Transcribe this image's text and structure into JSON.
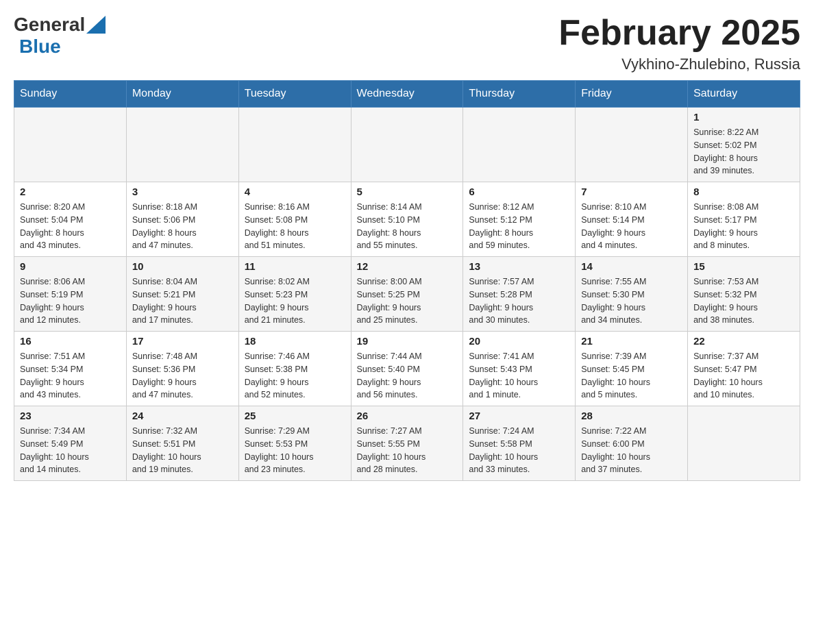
{
  "header": {
    "logo": {
      "text_general": "General",
      "text_blue": "Blue",
      "tagline": ""
    },
    "title": "February 2025",
    "subtitle": "Vykhino-Zhulebino, Russia"
  },
  "weekdays": [
    "Sunday",
    "Monday",
    "Tuesday",
    "Wednesday",
    "Thursday",
    "Friday",
    "Saturday"
  ],
  "weeks": [
    {
      "days": [
        {
          "num": "",
          "info": ""
        },
        {
          "num": "",
          "info": ""
        },
        {
          "num": "",
          "info": ""
        },
        {
          "num": "",
          "info": ""
        },
        {
          "num": "",
          "info": ""
        },
        {
          "num": "",
          "info": ""
        },
        {
          "num": "1",
          "info": "Sunrise: 8:22 AM\nSunset: 5:02 PM\nDaylight: 8 hours\nand 39 minutes."
        }
      ]
    },
    {
      "days": [
        {
          "num": "2",
          "info": "Sunrise: 8:20 AM\nSunset: 5:04 PM\nDaylight: 8 hours\nand 43 minutes."
        },
        {
          "num": "3",
          "info": "Sunrise: 8:18 AM\nSunset: 5:06 PM\nDaylight: 8 hours\nand 47 minutes."
        },
        {
          "num": "4",
          "info": "Sunrise: 8:16 AM\nSunset: 5:08 PM\nDaylight: 8 hours\nand 51 minutes."
        },
        {
          "num": "5",
          "info": "Sunrise: 8:14 AM\nSunset: 5:10 PM\nDaylight: 8 hours\nand 55 minutes."
        },
        {
          "num": "6",
          "info": "Sunrise: 8:12 AM\nSunset: 5:12 PM\nDaylight: 8 hours\nand 59 minutes."
        },
        {
          "num": "7",
          "info": "Sunrise: 8:10 AM\nSunset: 5:14 PM\nDaylight: 9 hours\nand 4 minutes."
        },
        {
          "num": "8",
          "info": "Sunrise: 8:08 AM\nSunset: 5:17 PM\nDaylight: 9 hours\nand 8 minutes."
        }
      ]
    },
    {
      "days": [
        {
          "num": "9",
          "info": "Sunrise: 8:06 AM\nSunset: 5:19 PM\nDaylight: 9 hours\nand 12 minutes."
        },
        {
          "num": "10",
          "info": "Sunrise: 8:04 AM\nSunset: 5:21 PM\nDaylight: 9 hours\nand 17 minutes."
        },
        {
          "num": "11",
          "info": "Sunrise: 8:02 AM\nSunset: 5:23 PM\nDaylight: 9 hours\nand 21 minutes."
        },
        {
          "num": "12",
          "info": "Sunrise: 8:00 AM\nSunset: 5:25 PM\nDaylight: 9 hours\nand 25 minutes."
        },
        {
          "num": "13",
          "info": "Sunrise: 7:57 AM\nSunset: 5:28 PM\nDaylight: 9 hours\nand 30 minutes."
        },
        {
          "num": "14",
          "info": "Sunrise: 7:55 AM\nSunset: 5:30 PM\nDaylight: 9 hours\nand 34 minutes."
        },
        {
          "num": "15",
          "info": "Sunrise: 7:53 AM\nSunset: 5:32 PM\nDaylight: 9 hours\nand 38 minutes."
        }
      ]
    },
    {
      "days": [
        {
          "num": "16",
          "info": "Sunrise: 7:51 AM\nSunset: 5:34 PM\nDaylight: 9 hours\nand 43 minutes."
        },
        {
          "num": "17",
          "info": "Sunrise: 7:48 AM\nSunset: 5:36 PM\nDaylight: 9 hours\nand 47 minutes."
        },
        {
          "num": "18",
          "info": "Sunrise: 7:46 AM\nSunset: 5:38 PM\nDaylight: 9 hours\nand 52 minutes."
        },
        {
          "num": "19",
          "info": "Sunrise: 7:44 AM\nSunset: 5:40 PM\nDaylight: 9 hours\nand 56 minutes."
        },
        {
          "num": "20",
          "info": "Sunrise: 7:41 AM\nSunset: 5:43 PM\nDaylight: 10 hours\nand 1 minute."
        },
        {
          "num": "21",
          "info": "Sunrise: 7:39 AM\nSunset: 5:45 PM\nDaylight: 10 hours\nand 5 minutes."
        },
        {
          "num": "22",
          "info": "Sunrise: 7:37 AM\nSunset: 5:47 PM\nDaylight: 10 hours\nand 10 minutes."
        }
      ]
    },
    {
      "days": [
        {
          "num": "23",
          "info": "Sunrise: 7:34 AM\nSunset: 5:49 PM\nDaylight: 10 hours\nand 14 minutes."
        },
        {
          "num": "24",
          "info": "Sunrise: 7:32 AM\nSunset: 5:51 PM\nDaylight: 10 hours\nand 19 minutes."
        },
        {
          "num": "25",
          "info": "Sunrise: 7:29 AM\nSunset: 5:53 PM\nDaylight: 10 hours\nand 23 minutes."
        },
        {
          "num": "26",
          "info": "Sunrise: 7:27 AM\nSunset: 5:55 PM\nDaylight: 10 hours\nand 28 minutes."
        },
        {
          "num": "27",
          "info": "Sunrise: 7:24 AM\nSunset: 5:58 PM\nDaylight: 10 hours\nand 33 minutes."
        },
        {
          "num": "28",
          "info": "Sunrise: 7:22 AM\nSunset: 6:00 PM\nDaylight: 10 hours\nand 37 minutes."
        },
        {
          "num": "",
          "info": ""
        }
      ]
    }
  ]
}
